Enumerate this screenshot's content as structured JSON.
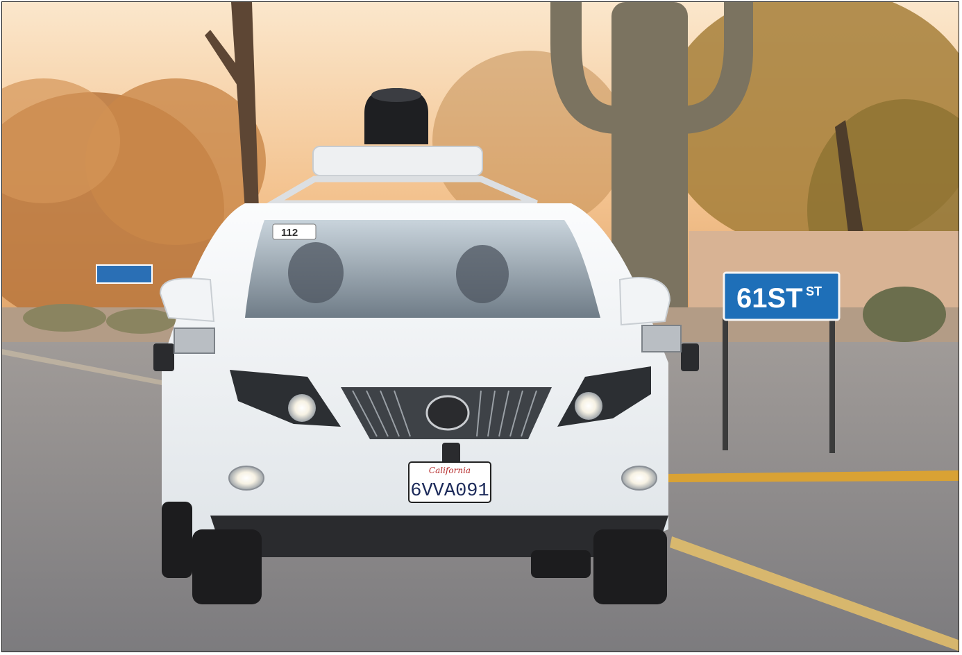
{
  "scene": {
    "street_sign": {
      "main": "61ST",
      "suffix": "ST"
    },
    "license_plate": {
      "state": "California",
      "number": "6VVA091"
    },
    "windshield_tag": "112",
    "colors": {
      "sky": "#f6d2a8",
      "road": "#8b8a8c",
      "car_body": "#f4f6f8",
      "sign_blue": "#1e6fb8",
      "curb_yellow": "#d9a234"
    }
  }
}
